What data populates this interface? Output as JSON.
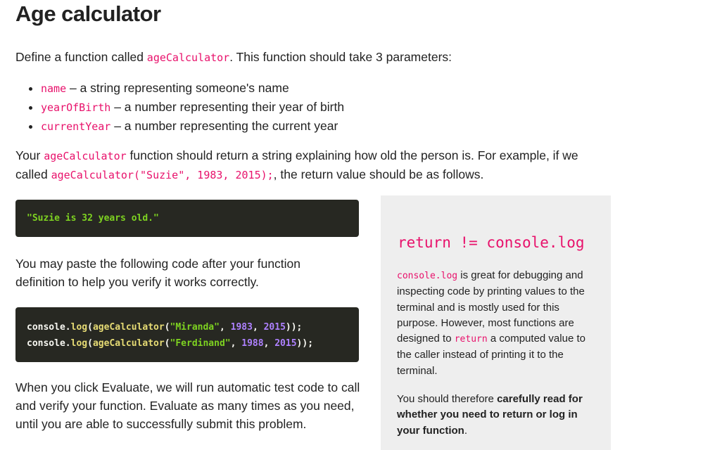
{
  "title": "Age calculator",
  "intro": {
    "pre": "Define a function called ",
    "fn": "ageCalculator",
    "post": ". This function should take 3 parameters:"
  },
  "params": [
    {
      "name": "name",
      "desc": " – a string representing someone's name"
    },
    {
      "name": "yearOfBirth",
      "desc": " – a number representing their year of birth"
    },
    {
      "name": "currentYear",
      "desc": " – a number representing the current year"
    }
  ],
  "explain": {
    "p1": "Your ",
    "fn": "ageCalculator",
    "p2": " function should return a string explaining how old the person is. For example, if we called ",
    "call": "ageCalculator(\"Suzie\", 1983, 2015);",
    "p3": ", the return value should be as follows."
  },
  "output_example": "\"Suzie is 32 years old.\"",
  "paste_text": "You may paste the following code after your function definition to help you verify it works correctly.",
  "code_lines": [
    {
      "obj": "console.",
      "method": "log",
      "fn": "ageCalculator",
      "str": "\"Miranda\"",
      "y1": "1983",
      "y2": "2015"
    },
    {
      "obj": "console.",
      "method": "log",
      "fn": "ageCalculator",
      "str": "\"Ferdinand\"",
      "y1": "1988",
      "y2": "2015"
    }
  ],
  "evaluate_text": "When you click Evaluate, we will run automatic test code to call and verify your function. Evaluate as many times as you need, until you are able to successfully submit this problem.",
  "sidebar": {
    "heading": "return != console.log",
    "p1_code": "console.log",
    "p1a": " is great for debugging and inspecting code by printing values to the terminal and is mostly used for this purpose. However, most functions are designed to ",
    "p1_return": "return",
    "p1b": " a computed value to the caller instead of printing it to the terminal.",
    "p2a": "You should therefore ",
    "p2_bold": "carefully read for whether you need to return or log in your function",
    "p2b": "."
  }
}
